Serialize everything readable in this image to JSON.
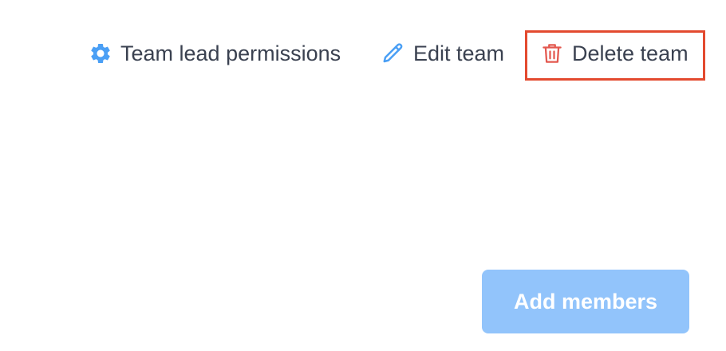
{
  "actions": {
    "permissions": {
      "label": "Team lead permissions",
      "icon": "gear-icon",
      "icon_color": "#4a9ff5"
    },
    "edit": {
      "label": "Edit team",
      "icon": "pencil-icon",
      "icon_color": "#4a9ff5"
    },
    "delete": {
      "label": "Delete team",
      "icon": "trash-icon",
      "icon_color": "#e3584f"
    }
  },
  "highlight": {
    "color": "#e34a2f"
  },
  "add_members": {
    "label": "Add members",
    "background": "#92c4fb"
  },
  "colors": {
    "text": "#3a4150",
    "background": "#ffffff"
  }
}
